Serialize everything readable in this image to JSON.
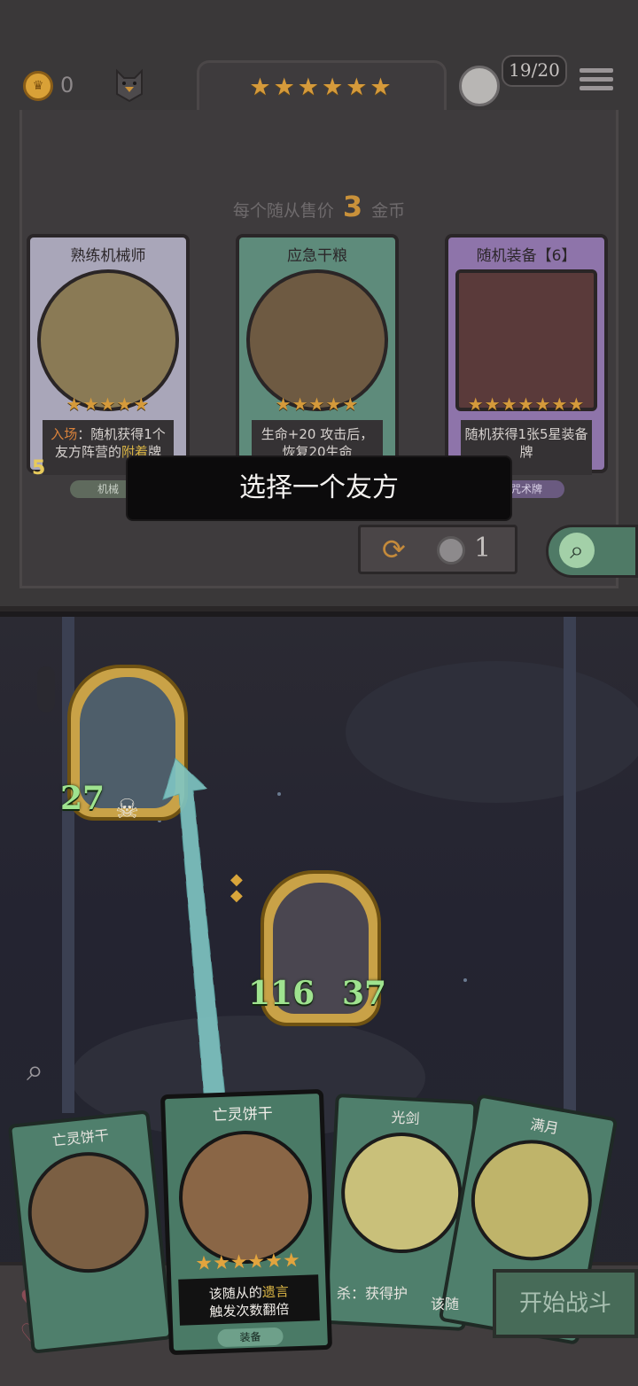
{
  "hud": {
    "gold": "0",
    "tier_stars": "★★★★★★",
    "player_hp": "19/20"
  },
  "shop": {
    "sell_prefix": "每个随从售价",
    "sell_price": "3",
    "sell_suffix": "金币",
    "cards": [
      {
        "title": "熟练机械师",
        "stars": "★★★★★",
        "desc_prefix": "入场",
        "desc_mid": "：随机获得1个友方阵营的",
        "desc_highlight": "附着",
        "desc_suffix": "牌",
        "tag": "机械",
        "cost": "5"
      },
      {
        "title": "应急干粮",
        "stars": "★★★★★",
        "desc": "生命+20 攻击后，恢复20生命"
      },
      {
        "title": "随机装备【6】",
        "stars": "★★★★★★★",
        "desc": "随机获得1张5星装备牌",
        "tag": "咒术牌"
      }
    ],
    "refresh_cost": "1"
  },
  "toast": "选择一个友方",
  "board": {
    "minions": [
      {
        "attack": "27"
      },
      {
        "attack": "116",
        "health": "37"
      }
    ]
  },
  "hand": [
    {
      "title": "亡灵饼干"
    },
    {
      "title": "亡灵饼干",
      "stars": "★★★★★★",
      "desc_prefix": "该随从的",
      "desc_highlight": "遗言",
      "desc_suffix": "触发次数翻倍",
      "tag": "装备"
    },
    {
      "title": "光剑",
      "desc": "杀：获得护"
    },
    {
      "title": "满月",
      "desc": "该随"
    }
  ],
  "start_button": "开始战斗",
  "colors": {
    "gold": "#d59a3b",
    "accent_green": "#4f7f6c",
    "stat_green": "#9fe38f"
  }
}
